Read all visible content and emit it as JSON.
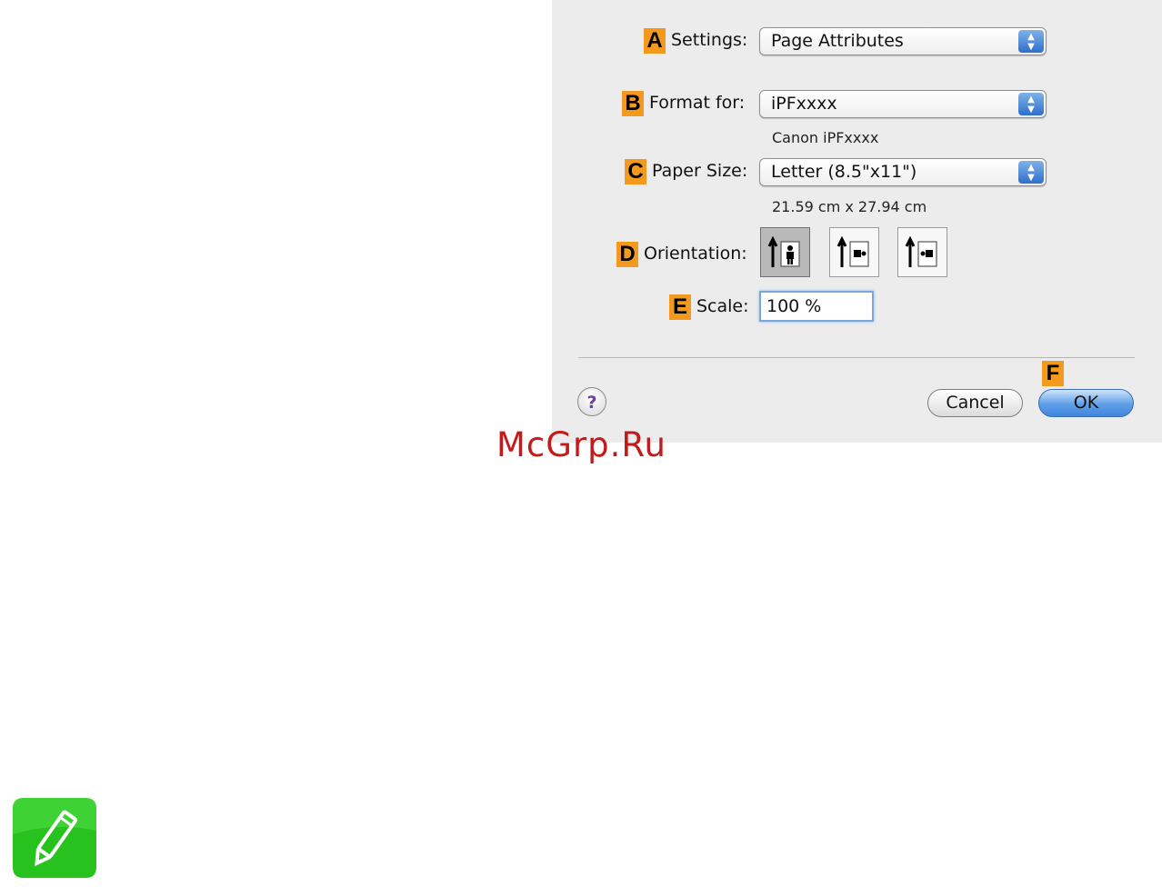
{
  "dialog": {
    "settings": {
      "marker": "A",
      "label": "Settings:",
      "value": "Page Attributes"
    },
    "format_for": {
      "marker": "B",
      "label": "Format for:",
      "value": "iPFxxxx",
      "sub": "Canon iPFxxxx"
    },
    "paper_size": {
      "marker": "C",
      "label": "Paper Size:",
      "value": "Letter (8.5\"x11\")",
      "sub": "21.59 cm x 27.94 cm"
    },
    "orientation": {
      "marker": "D",
      "label": "Orientation:",
      "selected_index": 0
    },
    "scale": {
      "marker": "E",
      "label": "Scale:",
      "value": "100 %"
    },
    "buttons": {
      "marker": "F",
      "help": "?",
      "cancel": "Cancel",
      "ok": "OK"
    }
  },
  "watermark": "McGrp.Ru",
  "colors": {
    "marker": "#f39a1e",
    "ok_button": "#5f9fe8",
    "watermark": "#c41a1a",
    "note_icon": "#27c21e"
  }
}
